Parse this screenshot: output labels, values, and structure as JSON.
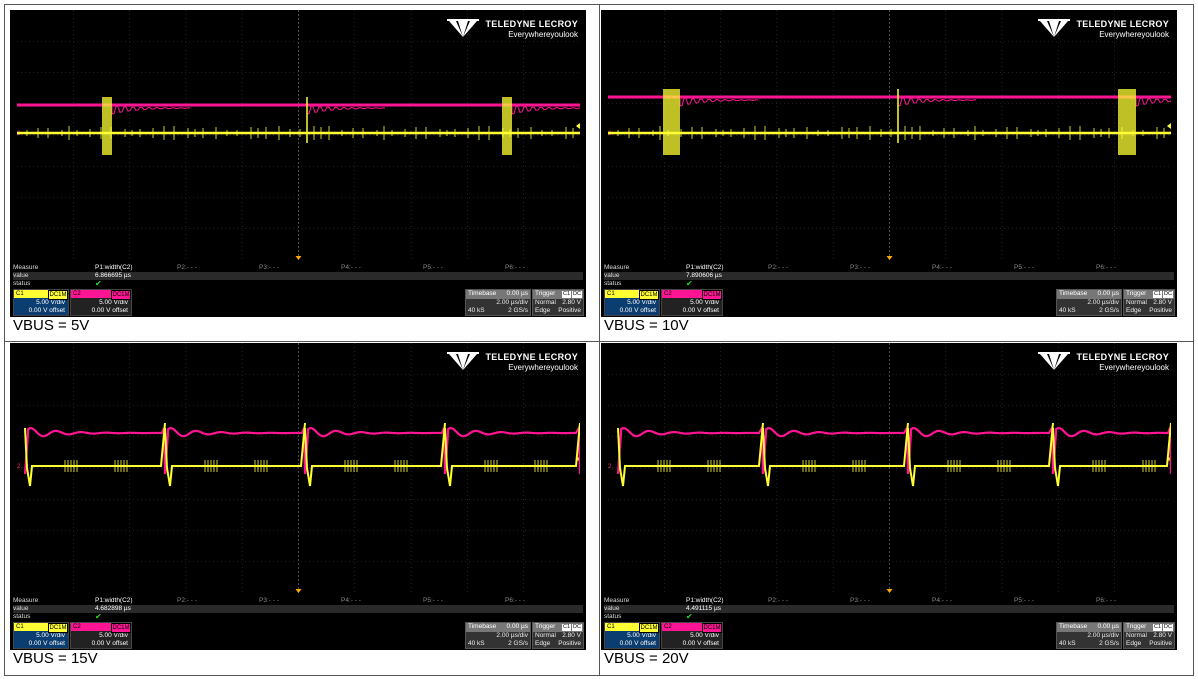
{
  "logo": {
    "brand": "TELEDYNE LECROY",
    "tagline": "Everywhereyoulook"
  },
  "panel_labels": {
    "measure": "Measure",
    "value": "value",
    "status": "status",
    "p1": "P1:width(C2)",
    "p2": "P2:- - -",
    "p3": "P3:- - -",
    "p4": "P4:- - -",
    "p5": "P5:- - -",
    "p6": "P6:- - -"
  },
  "channels": {
    "c1": {
      "name": "C1",
      "coupling": "DC1M",
      "vdiv": "5.00 V/div",
      "offset": "0.00 V offset"
    },
    "c2": {
      "name": "C2",
      "coupling": "DC1M",
      "vdiv": "5.00 V/div",
      "offset": "0.00 V offset"
    }
  },
  "timebase": {
    "label": "Timebase",
    "delay": "0.00 µs",
    "tdiv": "2.00 µs/div",
    "samples": "40 kS",
    "rate": "2 GS/s"
  },
  "trigger": {
    "label": "Trigger",
    "src": "C1",
    "coup": "DC",
    "mode": "Normal",
    "level": "2.80 V",
    "type": "Edge",
    "slope": "Positive"
  },
  "panels": [
    {
      "caption": "VBUS = 5V",
      "measure_value": "6.866695 µs"
    },
    {
      "caption": "VBUS = 10V",
      "measure_value": "7.890606 µs"
    },
    {
      "caption": "VBUS = 15V",
      "measure_value": "4.682898 µs"
    },
    {
      "caption": "VBUS = 20V",
      "measure_value": "4.491115 µs"
    }
  ],
  "colors": {
    "ch1": "#ffff33",
    "ch2": "#ff1493",
    "grid": "#3a3a3a",
    "background": "#000000"
  },
  "icons": {
    "checkmark": "status-check-icon",
    "logo": "teledyne-logo-icon",
    "trigger_marker": "trigger-marker-icon"
  }
}
